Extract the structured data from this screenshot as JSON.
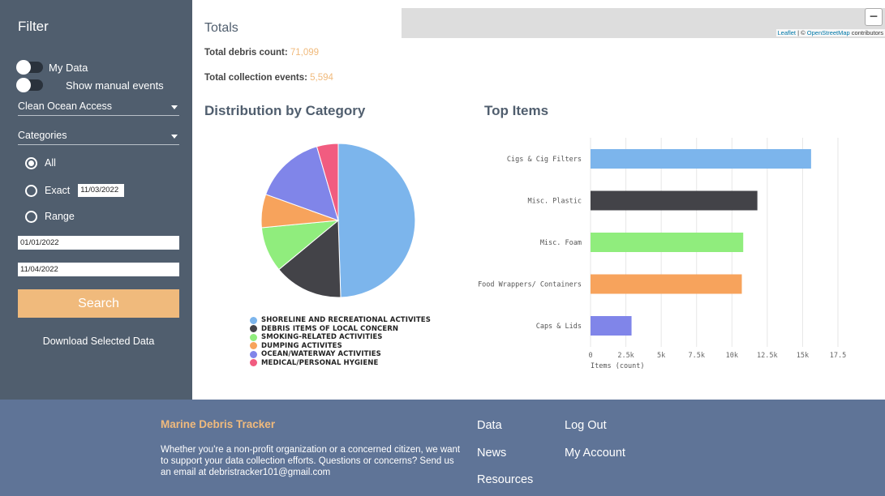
{
  "sidebar": {
    "title": "Filter",
    "toggles": [
      {
        "label": "My Data"
      },
      {
        "label": "Show manual events"
      }
    ],
    "org_select": "Clean Ocean Access",
    "categories_select": "Categories",
    "radios": {
      "all": "All",
      "exact": "Exact",
      "range": "Range",
      "selected": "all"
    },
    "exact_date": "11/03/2022",
    "range_start": "01/01/2022",
    "range_end": "11/04/2022",
    "search_label": "Search",
    "download_label": "Download Selected Data"
  },
  "map": {
    "zoom_out": "−",
    "attribution_leaflet": "Leaflet",
    "attribution_sep": " | © ",
    "attribution_osm": "OpenStreetMap",
    "attribution_tail": " contributors"
  },
  "totals": {
    "title": "Totals",
    "debris_label": "Total debris count: ",
    "debris_value": "71,099",
    "events_label": "Total collection events: ",
    "events_value": "5,594"
  },
  "distribution": {
    "title": "Distribution by Category"
  },
  "top_items": {
    "title": "Top Items"
  },
  "chart_data": [
    {
      "type": "pie",
      "title": "Distribution by Category",
      "categories": [
        "SHORELINE AND RECREATIONAL ACTIVITES",
        "DEBRIS ITEMS OF LOCAL CONCERN",
        "SMOKING-RELATED ACTIVITIES",
        "DUMPING ACTIVITES",
        "OCEAN/WATERWAY ACTIVITIES",
        "MEDICAL/PERSONAL HYGIENE"
      ],
      "values": [
        49.5,
        14.5,
        9.5,
        7.0,
        15.0,
        4.5
      ],
      "colors": [
        "#7cb5ec",
        "#434348",
        "#90ed7d",
        "#f7a35c",
        "#8085e9",
        "#f15c80"
      ],
      "legend": "bottom"
    },
    {
      "type": "bar",
      "orientation": "horizontal",
      "title": "Top Items",
      "categories": [
        "Cigs & Cig Filters",
        "Misc. Plastic",
        "Misc. Foam",
        "Food Wrappers/ Containers",
        "Caps & Lids"
      ],
      "values": [
        15600,
        11800,
        10800,
        10700,
        2900
      ],
      "colors": [
        "#7cb5ec",
        "#434348",
        "#90ed7d",
        "#f7a35c",
        "#8085e9"
      ],
      "xlabel": "Items (count)",
      "xlim": [
        0,
        17500
      ],
      "ticks": [
        0,
        2500,
        5000,
        7500,
        10000,
        12500,
        15000,
        17500
      ],
      "tick_labels": [
        "0",
        "2.5k",
        "5k",
        "7.5k",
        "10k",
        "12.5k",
        "15k",
        "17.5"
      ],
      "grid": true
    }
  ],
  "footer": {
    "title": "Marine Debris Tracker",
    "text": "Whether you're a non-profit organization or a concerned citizen, we want to support your data collection efforts. Questions or concerns? Send us an email at debristracker101@gmail.com",
    "links": {
      "data": "Data",
      "news": "News",
      "resources": "Resources",
      "logout": "Log Out",
      "account": "My Account"
    }
  }
}
